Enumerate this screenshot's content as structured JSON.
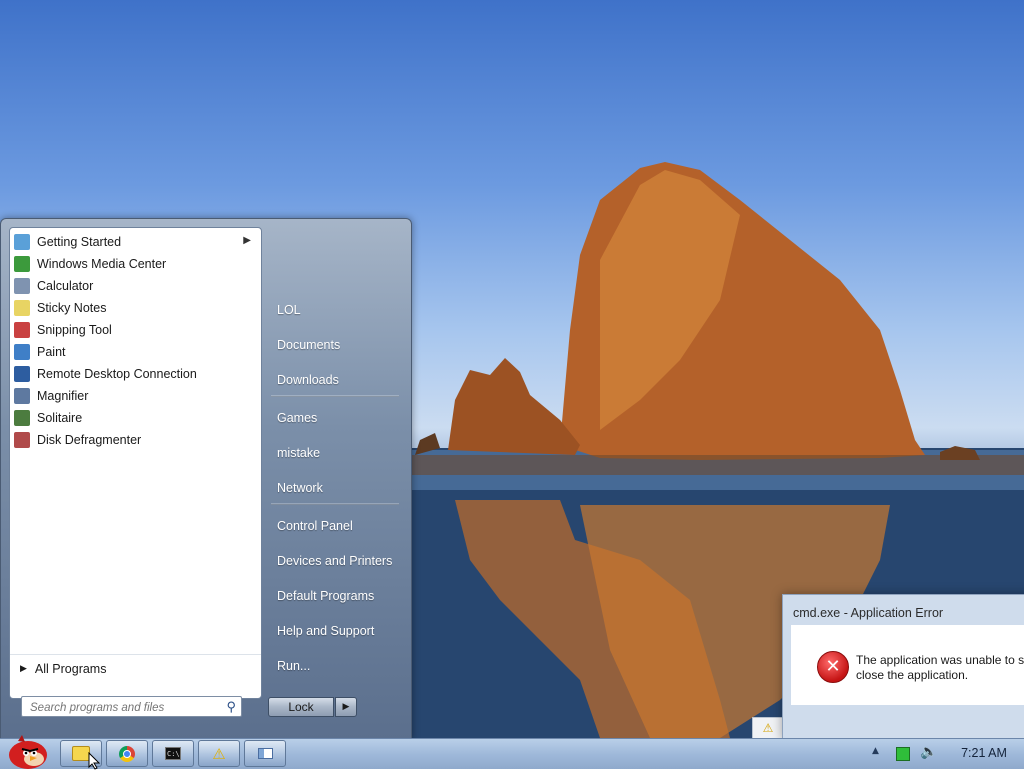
{
  "start_menu": {
    "programs": [
      {
        "label": "Getting Started",
        "icon": "getting-started-icon",
        "has_submenu": true,
        "color": "#5aa0d8"
      },
      {
        "label": "Windows Media Center",
        "icon": "media-center-icon",
        "has_submenu": false,
        "color": "#3c9a3c"
      },
      {
        "label": "Calculator",
        "icon": "calculator-icon",
        "has_submenu": false,
        "color": "#7f93b0"
      },
      {
        "label": "Sticky Notes",
        "icon": "sticky-notes-icon",
        "has_submenu": false,
        "color": "#e8d463"
      },
      {
        "label": "Snipping Tool",
        "icon": "snipping-tool-icon",
        "has_submenu": false,
        "color": "#c94141"
      },
      {
        "label": "Paint",
        "icon": "paint-icon",
        "has_submenu": false,
        "color": "#3f7fc7"
      },
      {
        "label": "Remote Desktop Connection",
        "icon": "remote-desktop-icon",
        "has_submenu": false,
        "color": "#2d5da0"
      },
      {
        "label": "Magnifier",
        "icon": "magnifier-icon",
        "has_submenu": false,
        "color": "#5e79a0"
      },
      {
        "label": "Solitaire",
        "icon": "solitaire-icon",
        "has_submenu": false,
        "color": "#4c7c3f"
      },
      {
        "label": "Disk Defragmenter",
        "icon": "disk-defragmenter-icon",
        "has_submenu": false,
        "color": "#b04a4a"
      }
    ],
    "all_programs": "All Programs",
    "search_placeholder": "Search programs and files",
    "right_items": [
      {
        "label": "LOL"
      },
      {
        "label": "Documents"
      },
      {
        "label": "Downloads"
      },
      {
        "label": "Games"
      },
      {
        "label": "mistake"
      },
      {
        "label": "Network"
      },
      {
        "label": "Control Panel"
      },
      {
        "label": "Devices and Printers"
      },
      {
        "label": "Default Programs"
      },
      {
        "label": "Help and Support"
      },
      {
        "label": "Run..."
      }
    ],
    "lock_label": "Lock"
  },
  "error_dialog": {
    "title": "cmd.exe - Application Error",
    "message_line1": "The application was unable to st",
    "message_line2": "close the application."
  },
  "taskbar": {
    "buttons": [
      {
        "icon": "explorer-folder-icon"
      },
      {
        "icon": "chrome-icon"
      },
      {
        "icon": "cmd-icon"
      },
      {
        "icon": "warning-icon"
      },
      {
        "icon": "window-icon"
      }
    ],
    "clock": "7:21 AM"
  }
}
